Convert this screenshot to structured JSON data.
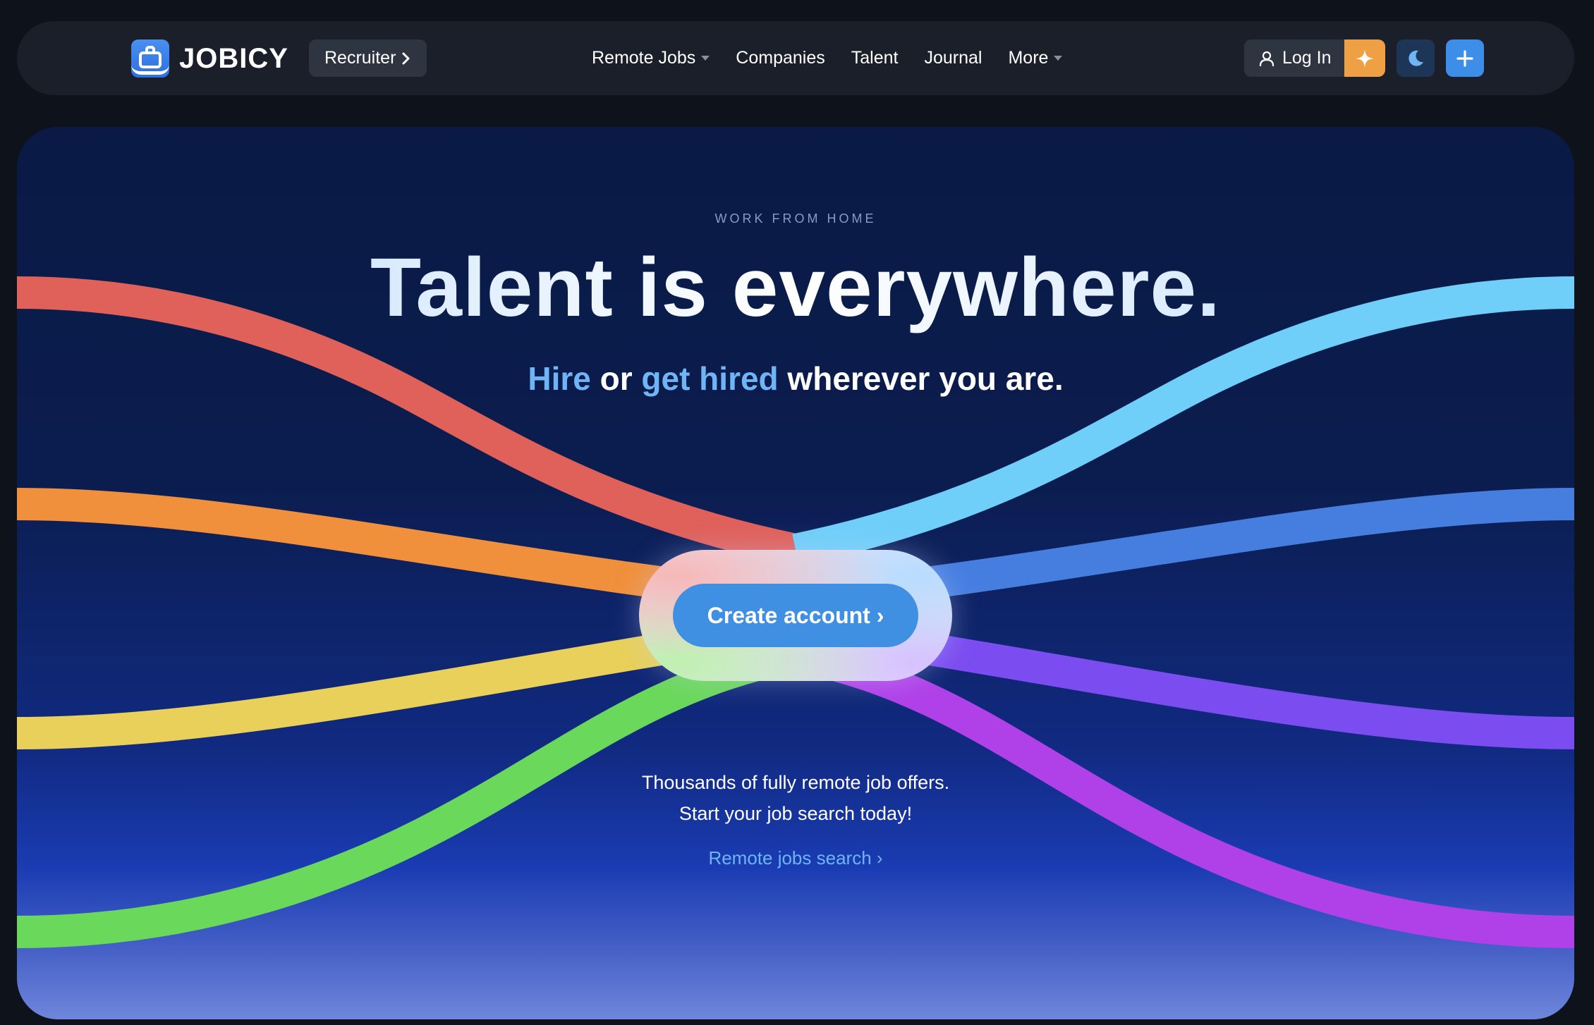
{
  "brand": {
    "name": "JOBICY",
    "icon": "briefcase-smile-icon",
    "color": "#3f8fe3"
  },
  "nav": {
    "recruiter_label": "Recruiter",
    "links": [
      {
        "label": "Remote Jobs",
        "has_dropdown": true
      },
      {
        "label": "Companies",
        "has_dropdown": false
      },
      {
        "label": "Talent",
        "has_dropdown": false
      },
      {
        "label": "Journal",
        "has_dropdown": false
      },
      {
        "label": "More",
        "has_dropdown": true
      }
    ],
    "login_label": "Log In",
    "icons": {
      "login": "user-icon",
      "ai": "sparkle-icon",
      "theme": "moon-icon",
      "post": "plus-icon"
    }
  },
  "hero": {
    "eyebrow": "WORK FROM HOME",
    "headline": "Talent is everywhere.",
    "sub": {
      "part1": "Hire",
      "part2": " or ",
      "part3": "get hired",
      "part4": " wherever you are."
    },
    "cta_label": "Create account ›",
    "blurb_line1": "Thousands of fully remote job offers.",
    "blurb_line2": "Start your job search today!",
    "search_link": "Remote jobs search ›"
  },
  "colors": {
    "nav_bg": "#1a1f29",
    "accent": "#3f8fe3",
    "link_accent": "#6fb5f5",
    "orange_button": "#f0a044",
    "wave_red": "#e0605a",
    "wave_orange": "#f0903c",
    "wave_yellow": "#e8d05a",
    "wave_green": "#6ad85a",
    "wave_cyan": "#6fcff8",
    "wave_blue": "#467ee0",
    "wave_violet": "#7b4cf0",
    "wave_purple": "#b040e8"
  }
}
